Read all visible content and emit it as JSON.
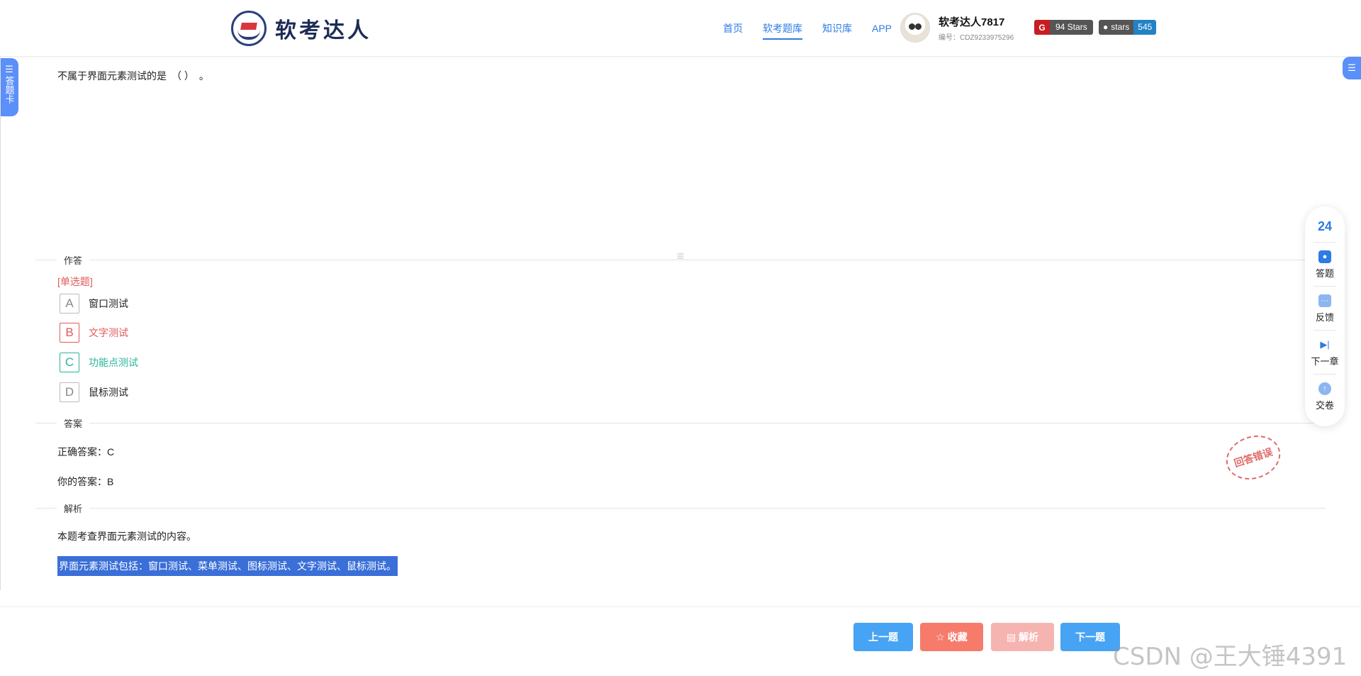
{
  "header": {
    "logo_text": "软考达人",
    "nav": [
      "首页",
      "软考题库",
      "知识库",
      "APP"
    ],
    "active_nav": "软考题库",
    "user_name": "软考达人7817",
    "user_id": "编号：CDZ9233975296",
    "gitee_badge": "94 Stars",
    "github_badge_label": "stars",
    "github_badge_count": "545"
  },
  "side_tabs": {
    "answer_card": "答题卡"
  },
  "question": {
    "text": "不属于界面元素测试的是　（ ）　。",
    "type": "[单选题]",
    "options": [
      {
        "letter": "A",
        "text": "窗口测试",
        "state": "normal"
      },
      {
        "letter": "B",
        "text": "文字测试",
        "state": "wrong"
      },
      {
        "letter": "C",
        "text": "功能点测试",
        "state": "correct"
      },
      {
        "letter": "D",
        "text": "鼠标测试",
        "state": "normal"
      }
    ]
  },
  "sections": {
    "answer_area": "作答",
    "answer": "答案",
    "analysis": "解析"
  },
  "answer": {
    "correct": "正确答案：C",
    "yours": "你的答案：B",
    "stamp": "回答错误"
  },
  "analysis": {
    "line1": "本题考查界面元素测试的内容。",
    "line2": "界面元素测试包括：窗口测试、菜单测试、图标测试、文字测试、鼠标测试。"
  },
  "toolbar": {
    "count": "24",
    "items": [
      "答题",
      "反馈",
      "下一章",
      "交卷"
    ]
  },
  "buttons": {
    "prev": "上一题",
    "favorite": "☆ 收藏",
    "analysis": "▤ 解析",
    "next": "下一题"
  },
  "watermark": "CSDN @王大锤4391"
}
